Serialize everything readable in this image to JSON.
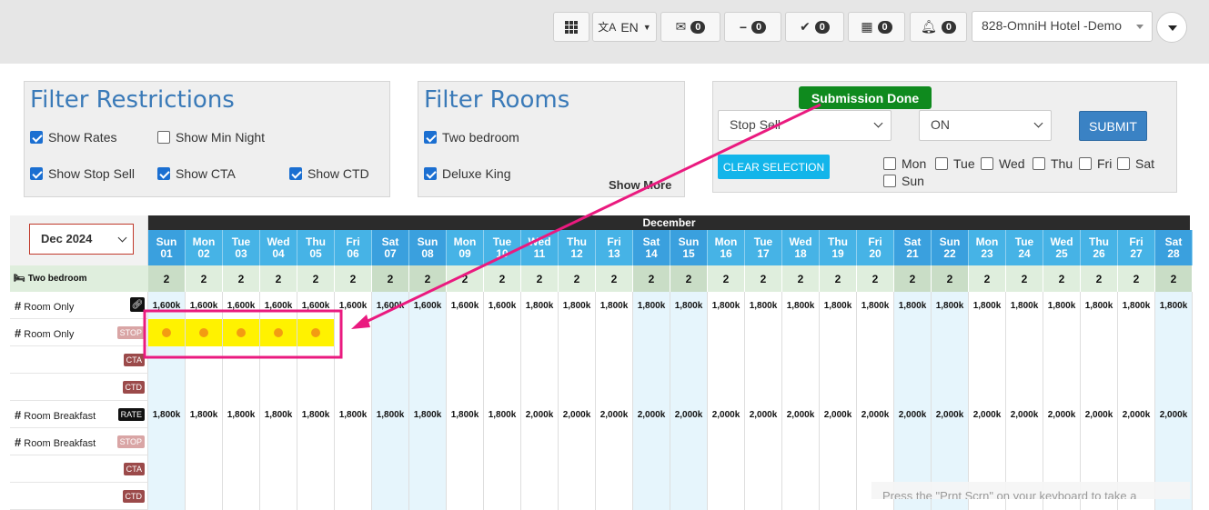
{
  "topbar": {
    "lang_label": "EN",
    "counters": [
      "0",
      "0",
      "0",
      "0",
      "0"
    ],
    "hotel": "828-OmniH Hotel -Demo"
  },
  "filter_restrictions": {
    "title": "Filter Restrictions",
    "items": [
      {
        "label": "Show Rates",
        "checked": true
      },
      {
        "label": "Show Min Night",
        "checked": false
      },
      {
        "label": "Show Stop Sell",
        "checked": true
      },
      {
        "label": "Show CTA",
        "checked": true
      },
      {
        "label": "Show CTD",
        "checked": true
      }
    ]
  },
  "filter_rooms": {
    "title": "Filter Rooms",
    "items": [
      {
        "label": "Two bedroom",
        "checked": true
      },
      {
        "label": "Deluxe King",
        "checked": true
      }
    ],
    "show_more": "Show More"
  },
  "bulk": {
    "toast": "Submission Done",
    "restriction": "Stop Sell",
    "value": "ON",
    "submit": "SUBMIT",
    "clear": "CLEAR SELECTION",
    "days": [
      "Mon",
      "Tue",
      "Wed",
      "Thu",
      "Fri",
      "Sat",
      "Sun"
    ]
  },
  "calendar": {
    "month_select": "Dec 2024",
    "month_header": "December",
    "days": [
      [
        "Sun",
        "01"
      ],
      [
        "Mon",
        "02"
      ],
      [
        "Tue",
        "03"
      ],
      [
        "Wed",
        "04"
      ],
      [
        "Thu",
        "05"
      ],
      [
        "Fri",
        "06"
      ],
      [
        "Sat",
        "07"
      ],
      [
        "Sun",
        "08"
      ],
      [
        "Mon",
        "09"
      ],
      [
        "Tue",
        "10"
      ],
      [
        "Wed",
        "11"
      ],
      [
        "Thu",
        "12"
      ],
      [
        "Fri",
        "13"
      ],
      [
        "Sat",
        "14"
      ],
      [
        "Sun",
        "15"
      ],
      [
        "Mon",
        "16"
      ],
      [
        "Tue",
        "17"
      ],
      [
        "Wed",
        "18"
      ],
      [
        "Thu",
        "19"
      ],
      [
        "Fri",
        "20"
      ],
      [
        "Sat",
        "21"
      ],
      [
        "Sun",
        "22"
      ],
      [
        "Mon",
        "23"
      ],
      [
        "Tue",
        "24"
      ],
      [
        "Wed",
        "25"
      ],
      [
        "Thu",
        "26"
      ],
      [
        "Fri",
        "27"
      ],
      [
        "Sat",
        "28"
      ]
    ],
    "room_name": "Two bedroom",
    "availability": "2",
    "rows": [
      {
        "label": "Room Only",
        "tag": "",
        "hash": true
      },
      {
        "label": "Room Only",
        "tag": "STOP",
        "hash": true
      },
      {
        "label": "",
        "tag": "CTA",
        "hash": false
      },
      {
        "label": "",
        "tag": "CTD",
        "hash": false
      },
      {
        "label": "Room Breakfast",
        "tag": "RATE",
        "hash": true
      },
      {
        "label": "Room Breakfast",
        "tag": "STOP",
        "hash": true
      },
      {
        "label": "",
        "tag": "CTA",
        "hash": false
      },
      {
        "label": "",
        "tag": "CTD",
        "hash": false
      }
    ],
    "rates_room_only": [
      "1,600k",
      "1,600k",
      "1,600k",
      "1,600k",
      "1,600k",
      "1,600k",
      "1,600k",
      "1,600k",
      "1,600k",
      "1,600k",
      "1,800k",
      "1,800k",
      "1,800k",
      "1,800k",
      "1,800k",
      "1,800k",
      "1,800k",
      "1,800k",
      "1,800k",
      "1,800k",
      "1,800k",
      "1,800k",
      "1,800k",
      "1,800k",
      "1,800k",
      "1,800k",
      "1,800k",
      "1,800k"
    ],
    "rates_breakfast": [
      "1,800k",
      "1,800k",
      "1,800k",
      "1,800k",
      "1,800k",
      "1,800k",
      "1,800k",
      "1,800k",
      "1,800k",
      "1,800k",
      "2,000k",
      "2,000k",
      "2,000k",
      "2,000k",
      "2,000k",
      "2,000k",
      "2,000k",
      "2,000k",
      "2,000k",
      "2,000k",
      "2,000k",
      "2,000k",
      "2,000k",
      "2,000k",
      "2,000k",
      "2,000k",
      "2,000k",
      "2,000k"
    ],
    "stop_sell_days": 5
  },
  "watermark": "Press the \"Prnt Scrn\" on your keyboard to take a"
}
